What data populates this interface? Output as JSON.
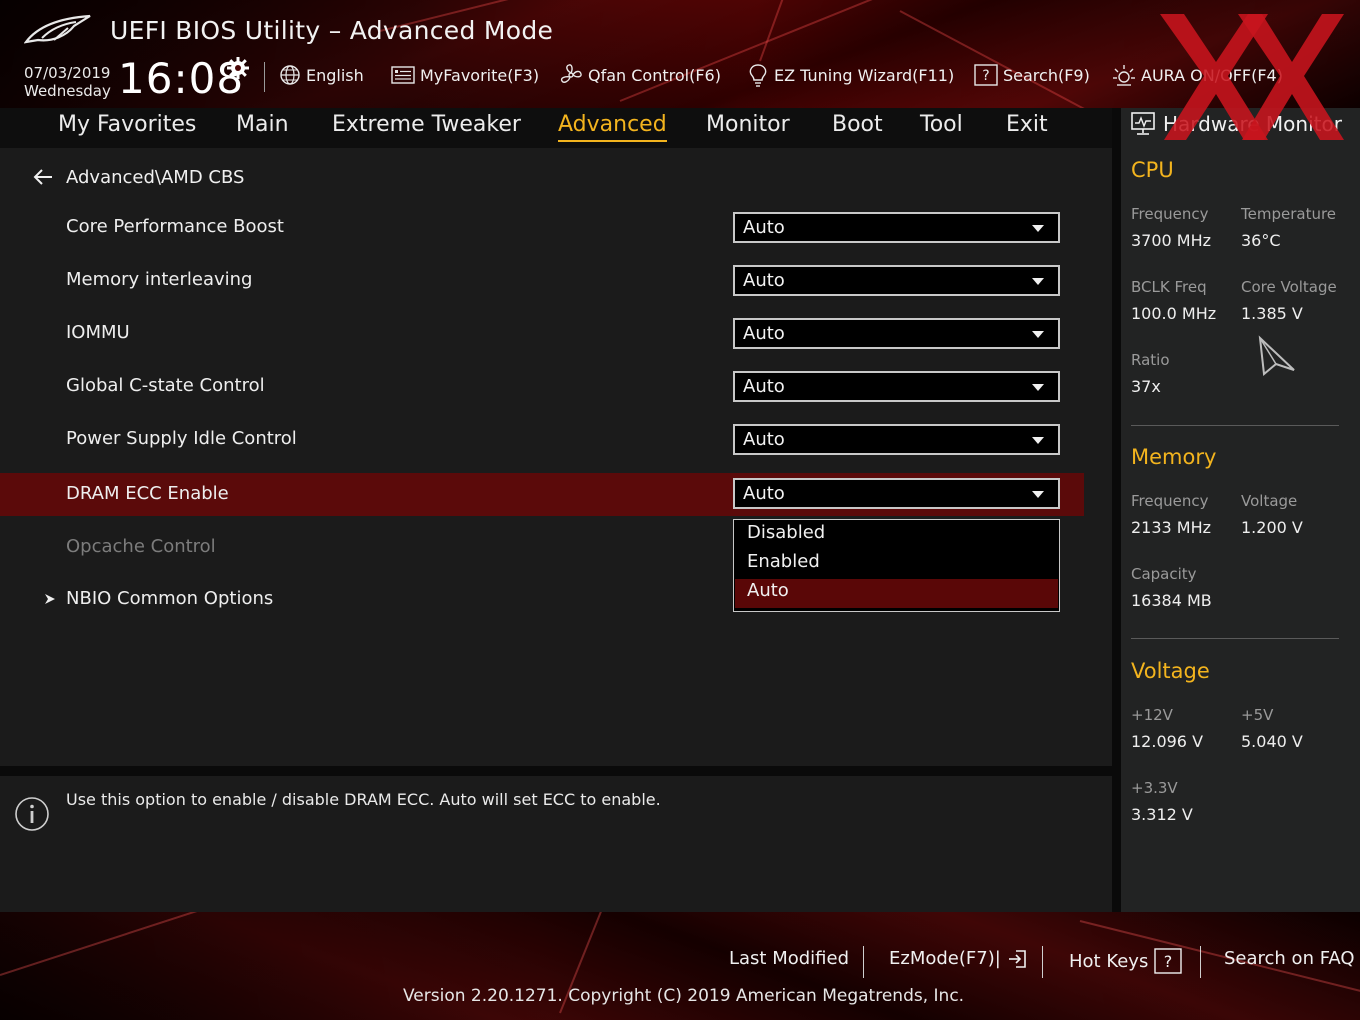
{
  "app": {
    "title": "UEFI BIOS Utility – Advanced Mode",
    "date": "07/03/2019",
    "weekday": "Wednesday",
    "time": "16:08"
  },
  "toolbar": {
    "language": "English",
    "myfavorite": "MyFavorite(F3)",
    "qfan": "Qfan Control(F6)",
    "ez_tuning": "EZ Tuning Wizard(F11)",
    "search": "Search(F9)",
    "aura": "AURA ON/OFF(F4)"
  },
  "nav": {
    "tabs": [
      {
        "label": "My Favorites",
        "active": false
      },
      {
        "label": "Main",
        "active": false
      },
      {
        "label": "Extreme Tweaker",
        "active": false
      },
      {
        "label": "Advanced",
        "active": true
      },
      {
        "label": "Monitor",
        "active": false
      },
      {
        "label": "Boot",
        "active": false
      },
      {
        "label": "Tool",
        "active": false
      },
      {
        "label": "Exit",
        "active": false
      }
    ]
  },
  "breadcrumb": "Advanced\\AMD CBS",
  "settings": [
    {
      "label": "Core Performance Boost",
      "value": "Auto"
    },
    {
      "label": "Memory interleaving",
      "value": "Auto"
    },
    {
      "label": "IOMMU",
      "value": "Auto"
    },
    {
      "label": "Global C-state Control",
      "value": "Auto"
    },
    {
      "label": "Power Supply Idle Control",
      "value": "Auto"
    },
    {
      "label": "DRAM ECC Enable",
      "value": "Auto"
    },
    {
      "label": "Opcache Control"
    }
  ],
  "submenu": {
    "label": "NBIO Common Options"
  },
  "dropdown_options": [
    "Disabled",
    "Enabled",
    "Auto"
  ],
  "dropdown_selected": "Auto",
  "help": {
    "text": "Use this option to enable / disable DRAM ECC. Auto will set ECC to enable."
  },
  "hw_monitor": {
    "title": "Hardware Monitor",
    "cpu": {
      "heading": "CPU",
      "frequency_label": "Frequency",
      "frequency": "3700 MHz",
      "temperature_label": "Temperature",
      "temperature": "36°C",
      "bclk_label": "BCLK Freq",
      "bclk": "100.0 MHz",
      "core_voltage_label": "Core Voltage",
      "core_voltage": "1.385 V",
      "ratio_label": "Ratio",
      "ratio": "37x"
    },
    "memory": {
      "heading": "Memory",
      "frequency_label": "Frequency",
      "frequency": "2133 MHz",
      "voltage_label": "Voltage",
      "voltage": "1.200 V",
      "capacity_label": "Capacity",
      "capacity": "16384 MB"
    },
    "voltage": {
      "heading": "Voltage",
      "v12_label": "+12V",
      "v12": "12.096 V",
      "v5_label": "+5V",
      "v5": "5.040 V",
      "v33_label": "+3.3V",
      "v33": "3.312 V"
    }
  },
  "footer": {
    "last_modified": "Last Modified",
    "ezmode": "EzMode(F7)|",
    "hot_keys": "Hot Keys",
    "search_faq": "Search on FAQ",
    "version": "Version 2.20.1271. Copyright (C) 2019 American Megatrends, Inc."
  },
  "colors": {
    "accent": "#f3b41e",
    "selected_row": "#5b0a0a",
    "brand_red": "#c8141e"
  },
  "icons": [
    "rog-logo-icon",
    "gear-icon",
    "globe-icon",
    "favorites-icon",
    "fan-icon",
    "lightbulb-icon",
    "search-box-icon",
    "aura-icon",
    "back-arrow-icon",
    "chevron-down-icon",
    "submenu-arrow-icon",
    "info-icon",
    "monitor-icon",
    "cursor-icon",
    "exit-icon",
    "help-box-icon"
  ]
}
